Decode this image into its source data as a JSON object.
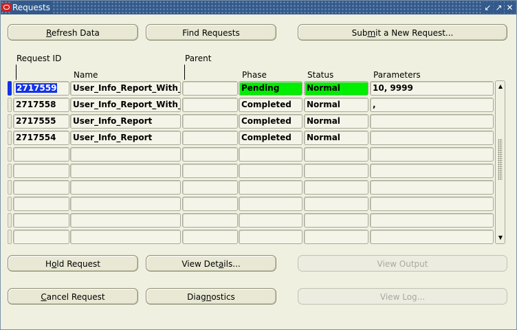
{
  "window": {
    "title": "Requests",
    "controls": {
      "minimize": "↙",
      "maximize": "↗",
      "close": "✕"
    }
  },
  "top_buttons": {
    "refresh": {
      "pre": "",
      "mnemonic": "R",
      "post": "efresh Data"
    },
    "find": {
      "pre": "",
      "mnemonic": "",
      "post": "Find Requests"
    },
    "submit": {
      "pre": "Sub",
      "mnemonic": "m",
      "post": "it a New Request..."
    }
  },
  "table": {
    "headers": {
      "request_id": "Request ID",
      "parent": "Parent",
      "name": "Name",
      "phase": "Phase",
      "status": "Status",
      "parameters": "Parameters"
    },
    "rows": [
      {
        "request_id": "2717559",
        "name": "User_Info_Report_With_P",
        "parent": "",
        "phase": "Pending",
        "status": "Normal",
        "parameters": "10, 9999"
      },
      {
        "request_id": "2717558",
        "name": "User_Info_Report_With_P",
        "parent": "",
        "phase": "Completed",
        "status": "Normal",
        "parameters": ","
      },
      {
        "request_id": "2717555",
        "name": "User_Info_Report",
        "parent": "",
        "phase": "Completed",
        "status": "Normal",
        "parameters": ""
      },
      {
        "request_id": "2717554",
        "name": "User_Info_Report",
        "parent": "",
        "phase": "Completed",
        "status": "Normal",
        "parameters": ""
      },
      {
        "request_id": "",
        "name": "",
        "parent": "",
        "phase": "",
        "status": "",
        "parameters": ""
      },
      {
        "request_id": "",
        "name": "",
        "parent": "",
        "phase": "",
        "status": "",
        "parameters": ""
      },
      {
        "request_id": "",
        "name": "",
        "parent": "",
        "phase": "",
        "status": "",
        "parameters": ""
      },
      {
        "request_id": "",
        "name": "",
        "parent": "",
        "phase": "",
        "status": "",
        "parameters": ""
      },
      {
        "request_id": "",
        "name": "",
        "parent": "",
        "phase": "",
        "status": "",
        "parameters": ""
      },
      {
        "request_id": "",
        "name": "",
        "parent": "",
        "phase": "",
        "status": "",
        "parameters": ""
      }
    ],
    "highlight_color": "#00ee00",
    "selection_color": "#1432e6",
    "scroll": {
      "up": "▲",
      "down": "▼"
    }
  },
  "bottom_buttons": {
    "hold": {
      "pre": "H",
      "mnemonic": "o",
      "post": "ld Request"
    },
    "view_details": {
      "pre": "View Det",
      "mnemonic": "a",
      "post": "ils..."
    },
    "view_output": {
      "pre": "",
      "mnemonic": "",
      "post": "View Output"
    },
    "cancel": {
      "pre": "",
      "mnemonic": "C",
      "post": "ancel Request"
    },
    "diagnostics": {
      "pre": "Diag",
      "mnemonic": "n",
      "post": "ostics"
    },
    "view_log": {
      "pre": "",
      "mnemonic": "",
      "post": "View Log..."
    }
  }
}
